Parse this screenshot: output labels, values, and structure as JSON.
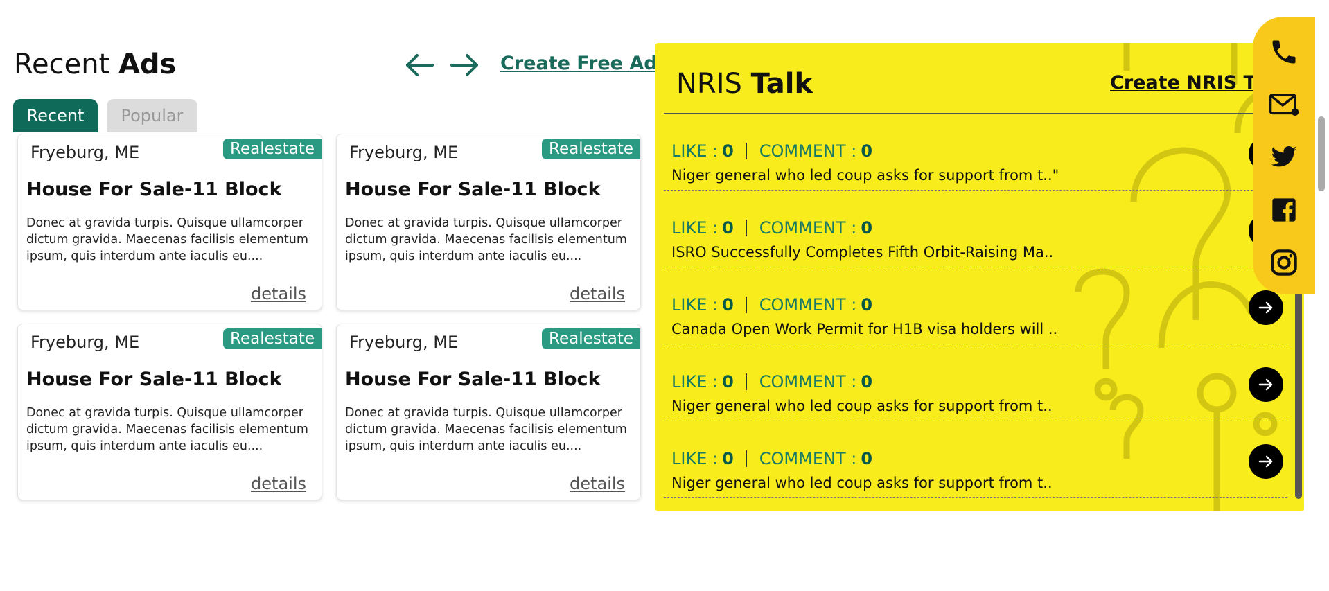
{
  "recent_ads": {
    "title_light": "Recent",
    "title_bold": "Ads",
    "create_link": "Create Free Ad",
    "tabs": [
      {
        "label": "Recent",
        "active": true
      },
      {
        "label": "Popular",
        "active": false
      }
    ],
    "cards": [
      {
        "location": "Fryeburg, ME",
        "category": "Realestate",
        "title": "House For Sale-11 Block",
        "description": "Donec at gravida turpis. Quisque ullamcorper dictum gravida. Maecenas facilisis elementum ipsum, quis interdum ante iaculis eu....",
        "details": "details"
      },
      {
        "location": "Fryeburg, ME",
        "category": "Realestate",
        "title": "House For Sale-11 Block",
        "description": "Donec at gravida turpis. Quisque ullamcorper dictum gravida. Maecenas facilisis elementum ipsum, quis interdum ante iaculis eu....",
        "details": "details"
      },
      {
        "location": "Fryeburg, ME",
        "category": "Realestate",
        "title": "House For Sale-11 Block",
        "description": "Donec at gravida turpis. Quisque ullamcorper dictum gravida. Maecenas facilisis elementum ipsum, quis interdum ante iaculis eu....",
        "details": "details"
      },
      {
        "location": "Fryeburg, ME",
        "category": "Realestate",
        "title": "House For Sale-11 Block",
        "description": "Donec at gravida turpis. Quisque ullamcorper dictum gravida. Maecenas facilisis elementum ipsum, quis interdum ante iaculis eu....",
        "details": "details"
      }
    ]
  },
  "nris_talk": {
    "title_light": "NRIS",
    "title_bold": "Talk",
    "create_link": "Create NRIS Talk",
    "like_label": "LIKE :",
    "comment_label": "COMMENT :",
    "items": [
      {
        "likes": "0",
        "comments": "0",
        "text": "Niger general who led coup asks for support from t..\""
      },
      {
        "likes": "0",
        "comments": "0",
        "text": "ISRO Successfully Completes Fifth Orbit-Raising Ma.."
      },
      {
        "likes": "0",
        "comments": "0",
        "text": "Canada Open Work Permit for H1B visa holders will .."
      },
      {
        "likes": "0",
        "comments": "0",
        "text": "Niger general who led coup asks for support from t.."
      },
      {
        "likes": "0",
        "comments": "0",
        "text": "Niger general who led coup asks for support from t.."
      }
    ]
  },
  "side_bar": {
    "icons": [
      "phone-icon",
      "mail-icon",
      "twitter-icon",
      "facebook-icon",
      "instagram-icon"
    ]
  },
  "colors": {
    "accent_green": "#0f6a5a",
    "badge_green": "#2a9a82",
    "talk_yellow": "#f8ec1c",
    "side_yellow": "#f8c91a"
  }
}
